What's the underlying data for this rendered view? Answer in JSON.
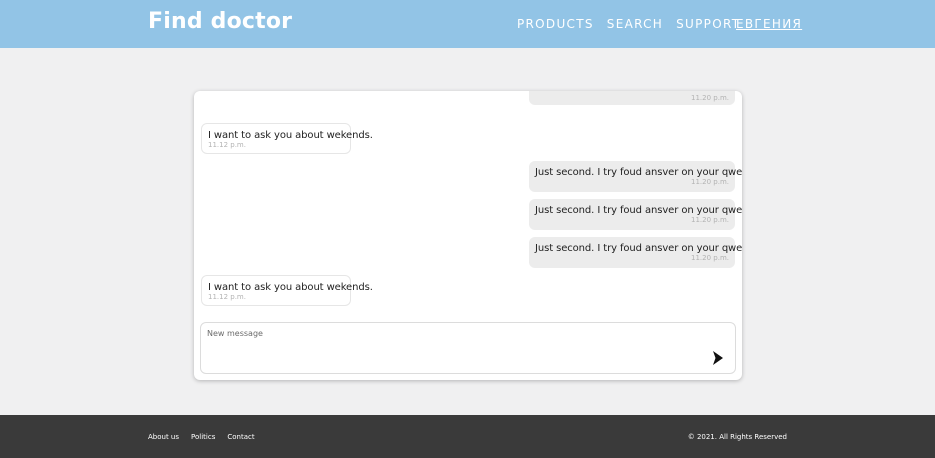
{
  "header": {
    "logo": "Find doctor",
    "nav": [
      "PRODUCTS",
      "SEARCH",
      "SUPPORT"
    ],
    "user": "ЕВГЕНИЯ"
  },
  "chat": {
    "messages": [
      {
        "side": "out",
        "text": "",
        "time": "11.20 p.m."
      },
      {
        "side": "in",
        "text": "I want to ask you about wekends.",
        "time": "11.12 p.m."
      },
      {
        "side": "out",
        "text": "Just second. I try foud ansver on your qwestion.",
        "time": "11.20 p.m."
      },
      {
        "side": "out",
        "text": "Just second. I try foud ansver on your qwestion.",
        "time": "11.20 p.m."
      },
      {
        "side": "out",
        "text": "Just second. I try foud ansver on your qwestion.",
        "time": "11.20 p.m."
      },
      {
        "side": "in",
        "text": "I want to ask you about wekends.",
        "time": "11.12 p.m."
      }
    ],
    "composer": {
      "placeholder": "New message",
      "send_icon": "send-arrow-icon"
    }
  },
  "footer": {
    "links": [
      "About us",
      "Politics",
      "Contact"
    ],
    "copyright": "© 2021. All Rights Reserved"
  },
  "colors": {
    "header_bg": "#92c4e6",
    "page_bg": "#f0f0f1",
    "footer_bg": "#3a3a3a",
    "bubble_out": "#ececec"
  }
}
